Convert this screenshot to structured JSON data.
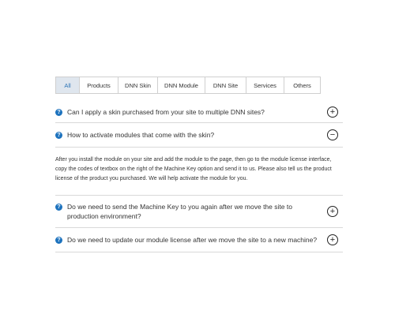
{
  "tabs": [
    {
      "label": "All",
      "active": true
    },
    {
      "label": "Products",
      "active": false
    },
    {
      "label": "DNN Skin",
      "active": false
    },
    {
      "label": "DNN Module",
      "active": false
    },
    {
      "label": "DNN Site",
      "active": false
    },
    {
      "label": "Services",
      "active": false
    },
    {
      "label": "Others",
      "active": false
    }
  ],
  "faq": [
    {
      "question": "Can I apply a skin purchased from your site to multiple DNN sites?",
      "toggle": "+",
      "expanded": false
    },
    {
      "question": "How to activate modules that come with the skin?",
      "toggle": "−",
      "expanded": true,
      "answer": "After you install the module on your site and add the module to the page, then go to the module license interface, copy the codes of textbox on the right of the Machine Key option and send it to us. Please also tell us the product license of the product you purchased. We will help activate the module for you."
    },
    {
      "question": "Do we need to send the Machine Key to you again after we move the site to production environment?",
      "toggle": "+",
      "expanded": false
    },
    {
      "question": "Do we need to update our module license after we move the site to a new machine?",
      "toggle": "+",
      "expanded": false
    }
  ],
  "icons": {
    "question": "?"
  },
  "colors": {
    "accent": "#1e73be",
    "active_tab_bg": "#dfe6ee"
  }
}
